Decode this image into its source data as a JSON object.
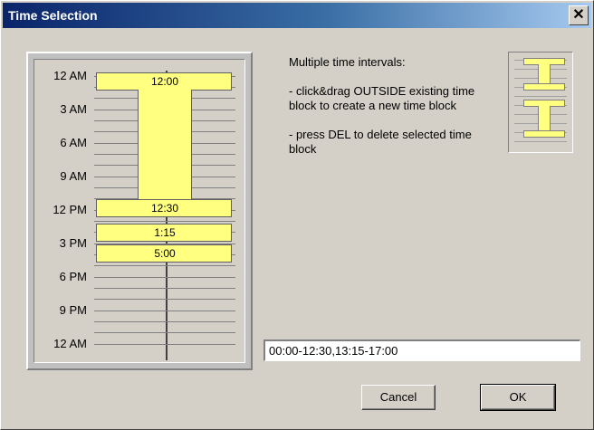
{
  "window": {
    "title": "Time Selection",
    "close_label": "✕"
  },
  "timeline": {
    "ticks": [
      "12 AM",
      "3 AM",
      "6 AM",
      "9 AM",
      "12 PM",
      "3 PM",
      "6 PM",
      "9 PM",
      "12 AM"
    ],
    "blocks": [
      {
        "start_label": "12:00",
        "end_label": "12:30"
      },
      {
        "start_label": "1:15",
        "end_label": "5:00"
      }
    ]
  },
  "instructions": {
    "heading": "Multiple time intervals:",
    "step1": " - click&drag OUTSIDE existing time block to create a new time block",
    "step2": "- press DEL to delete selected time block"
  },
  "result_value": "00:00-12:30,13:15-17:00",
  "buttons": {
    "cancel": "Cancel",
    "ok": "OK"
  }
}
